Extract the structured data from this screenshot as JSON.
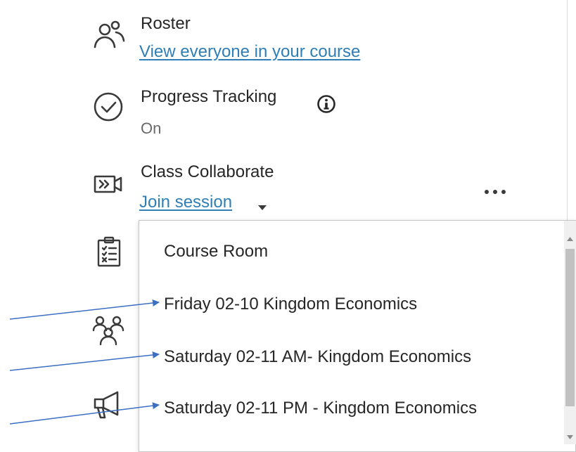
{
  "roster": {
    "title": "Roster",
    "link": "View everyone in your course"
  },
  "progress": {
    "title": "Progress Tracking",
    "status": "On"
  },
  "collaborate": {
    "title": "Class Collaborate",
    "link": "Join session"
  },
  "dropdown": {
    "options": [
      "Course Room",
      "Friday 02-10 Kingdom Economics",
      "Saturday 02-11 AM- Kingdom Economics",
      "Saturday 02-11 PM - Kingdom Economics"
    ]
  },
  "icons": {
    "roster": "people-icon",
    "progress": "checkmark-circle-icon",
    "collaborate": "video-camera-icon",
    "rubric": "clipboard-checklist-icon",
    "groups": "groups-icon",
    "announcements": "megaphone-icon",
    "info": "info-icon",
    "caret": "caret-down-icon",
    "more": "more-options-icon"
  },
  "colors": {
    "link": "#2f7fb6",
    "annotation_arrow": "#3b6fc4",
    "text": "#262626",
    "muted_text": "#6a6a6a"
  }
}
